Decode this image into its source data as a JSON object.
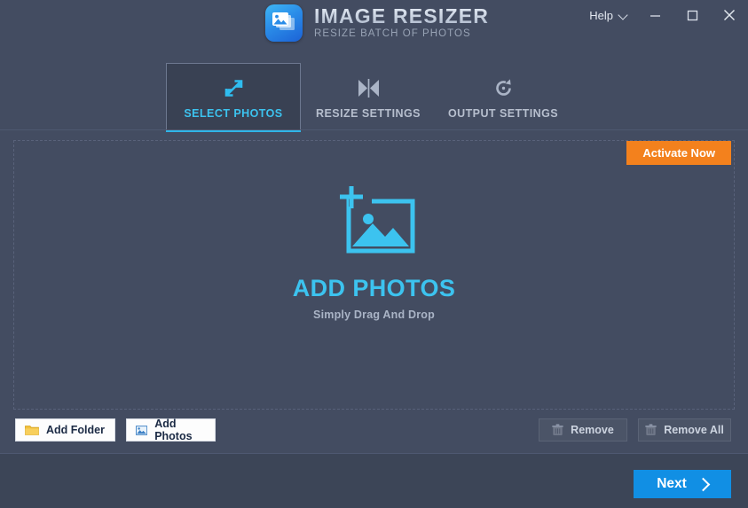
{
  "titlebar": {
    "help_label": "Help",
    "help_icon": "chevron-down-icon",
    "minimize_icon": "minimize-icon",
    "maximize_icon": "maximize-icon",
    "close_icon": "close-icon"
  },
  "brand": {
    "icon": "image-resizer-app-icon",
    "title": "IMAGE RESIZER",
    "subtitle": "RESIZE BATCH OF PHOTOS"
  },
  "tabs": [
    {
      "label": "SELECT PHOTOS",
      "icon": "expand-arrows-icon",
      "active": true
    },
    {
      "label": "RESIZE SETTINGS",
      "icon": "resize-compress-icon",
      "active": false
    },
    {
      "label": "OUTPUT SETTINGS",
      "icon": "rotate-refresh-icon",
      "active": false
    }
  ],
  "activate": {
    "label": "Activate Now"
  },
  "dropzone": {
    "icon": "add-photo-frame-icon",
    "title": "ADD PHOTOS",
    "subtitle": "Simply Drag And Drop"
  },
  "actions": {
    "add_folder": {
      "label": "Add Folder",
      "icon": "folder-icon"
    },
    "add_photos": {
      "label": "Add Photos",
      "icon": "photo-icon"
    },
    "remove": {
      "label": "Remove",
      "icon": "trash-icon"
    },
    "remove_all": {
      "label": "Remove All",
      "icon": "trash-icon"
    }
  },
  "footer": {
    "next_label": "Next",
    "next_icon": "chevron-right-icon"
  },
  "colors": {
    "window_bg": "#434c61",
    "footer_bg": "#3c4557",
    "accent_cyan": "#3cc3ef",
    "accent_orange": "#f3811d",
    "accent_blue": "#118fe4"
  }
}
